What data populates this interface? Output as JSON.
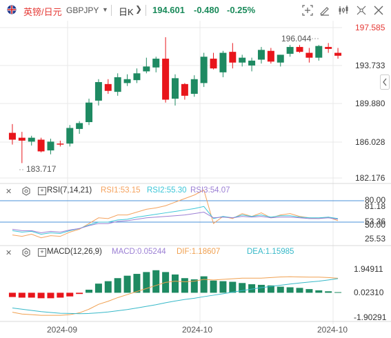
{
  "toolbar": {
    "pair_name": "英镑/日元",
    "symbol": "GBPJPY",
    "period": "日K",
    "price": "194.601",
    "change": "-0.480",
    "change_pct": "-0.25%"
  },
  "colors": {
    "up": "#1e8a62",
    "down": "#e8151b",
    "rsi1": "#f5a25d",
    "rsi2": "#3cc6d8",
    "rsi3": "#9b7fd4",
    "dif": "#f0a050",
    "dea": "#36b8c8",
    "grid": "#e8e8e8"
  },
  "icons": [
    "flag-uk-icon",
    "crosshair-icon",
    "draw-line-icon",
    "indicators-icon",
    "shapes-icon",
    "fullscreen-icon",
    "close-icon",
    "chevron-down-icon",
    "chevron-left-icon",
    "gear-icon",
    "plus-box-icon"
  ],
  "chart_data": [
    {
      "type": "candlestick",
      "title": "GBPJPY 日K",
      "y_ticks": [
        "197.585",
        "193.733",
        "189.880",
        "186.028",
        "182.176"
      ],
      "ylim": [
        182.176,
        197.585
      ],
      "x_ticks": [
        "2024-09",
        "2024-10",
        "2024-10"
      ],
      "annotations": {
        "high": "196.044",
        "low": "183.717"
      },
      "candles": [
        {
          "o": 186.8,
          "h": 187.7,
          "l": 185.6,
          "c": 186.1
        },
        {
          "o": 186.3,
          "h": 186.9,
          "l": 183.7,
          "c": 186.0
        },
        {
          "o": 185.9,
          "h": 186.5,
          "l": 185.5,
          "c": 186.3
        },
        {
          "o": 186.1,
          "h": 186.3,
          "l": 184.8,
          "c": 184.9
        },
        {
          "o": 185.0,
          "h": 186.2,
          "l": 184.6,
          "c": 185.9
        },
        {
          "o": 185.7,
          "h": 186.0,
          "l": 185.4,
          "c": 185.6
        },
        {
          "o": 185.7,
          "h": 187.6,
          "l": 185.4,
          "c": 187.3
        },
        {
          "o": 187.2,
          "h": 188.0,
          "l": 186.7,
          "c": 187.8
        },
        {
          "o": 187.9,
          "h": 190.3,
          "l": 187.6,
          "c": 189.9
        },
        {
          "o": 190.1,
          "h": 192.3,
          "l": 189.6,
          "c": 192.0
        },
        {
          "o": 191.8,
          "h": 192.3,
          "l": 190.8,
          "c": 191.1
        },
        {
          "o": 191.0,
          "h": 192.9,
          "l": 190.6,
          "c": 192.5
        },
        {
          "o": 191.9,
          "h": 192.8,
          "l": 191.6,
          "c": 192.3
        },
        {
          "o": 192.2,
          "h": 193.4,
          "l": 191.9,
          "c": 192.9
        },
        {
          "o": 193.1,
          "h": 194.5,
          "l": 192.9,
          "c": 193.6
        },
        {
          "o": 193.5,
          "h": 194.6,
          "l": 193.0,
          "c": 194.4
        },
        {
          "o": 194.4,
          "h": 196.6,
          "l": 189.9,
          "c": 190.2
        },
        {
          "o": 190.3,
          "h": 192.8,
          "l": 189.6,
          "c": 192.4
        },
        {
          "o": 191.8,
          "h": 191.9,
          "l": 190.2,
          "c": 190.6
        },
        {
          "o": 190.8,
          "h": 192.7,
          "l": 190.5,
          "c": 192.3
        },
        {
          "o": 191.9,
          "h": 195.0,
          "l": 191.5,
          "c": 194.6
        },
        {
          "o": 194.4,
          "h": 195.0,
          "l": 193.3,
          "c": 193.4
        },
        {
          "o": 193.0,
          "h": 195.2,
          "l": 192.5,
          "c": 195.0
        },
        {
          "o": 195.1,
          "h": 196.0,
          "l": 193.4,
          "c": 194.0
        },
        {
          "o": 194.0,
          "h": 194.8,
          "l": 193.6,
          "c": 194.5
        },
        {
          "o": 193.7,
          "h": 194.5,
          "l": 193.1,
          "c": 194.2
        },
        {
          "o": 194.3,
          "h": 195.6,
          "l": 193.9,
          "c": 195.3
        },
        {
          "o": 195.2,
          "h": 195.5,
          "l": 193.9,
          "c": 194.1
        },
        {
          "o": 194.0,
          "h": 194.8,
          "l": 193.6,
          "c": 194.8
        },
        {
          "o": 194.9,
          "h": 195.8,
          "l": 194.6,
          "c": 195.6
        },
        {
          "o": 195.6,
          "h": 195.8,
          "l": 195.0,
          "c": 195.1
        },
        {
          "o": 195.0,
          "h": 195.5,
          "l": 194.0,
          "c": 194.5
        },
        {
          "o": 194.5,
          "h": 195.8,
          "l": 194.2,
          "c": 195.7
        },
        {
          "o": 195.6,
          "h": 196.0,
          "l": 195.0,
          "c": 195.4
        },
        {
          "o": 195.0,
          "h": 195.5,
          "l": 194.4,
          "c": 194.7
        }
      ]
    },
    {
      "type": "line",
      "name": "RSI",
      "header": {
        "label": "RSI(7,14,21)",
        "rsi1": "RSI1:53.15",
        "rsi2": "RSI2:55.30",
        "rsi3": "RSI3:54.07"
      },
      "y_ticks": [
        "80.00",
        "81.18",
        "53.36",
        "50.00",
        "25.53"
      ],
      "ylim": [
        15,
        90
      ],
      "reference_lines": [
        80,
        50
      ],
      "series": [
        {
          "name": "RSI1",
          "values": [
            32,
            30,
            33,
            28,
            31,
            30,
            36,
            40,
            48,
            56,
            55,
            60,
            60,
            64,
            68,
            70,
            73,
            78,
            83,
            88,
            95,
            48,
            58,
            55,
            62,
            58,
            63,
            56,
            60,
            62,
            58,
            56,
            55,
            57,
            52
          ]
        },
        {
          "name": "RSI2",
          "values": [
            38,
            36,
            37,
            33,
            35,
            34,
            38,
            41,
            46,
            50,
            50,
            53,
            54,
            57,
            59,
            61,
            63,
            65,
            67,
            69,
            72,
            55,
            58,
            56,
            60,
            58,
            60,
            57,
            59,
            59,
            57,
            56,
            56,
            57,
            55
          ]
        },
        {
          "name": "RSI3",
          "values": [
            40,
            38,
            38,
            35,
            37,
            36,
            39,
            41,
            45,
            48,
            48,
            51,
            52,
            54,
            56,
            57,
            58,
            59,
            60,
            62,
            64,
            56,
            57,
            56,
            58,
            57,
            58,
            56,
            57,
            57,
            56,
            55,
            55,
            56,
            54
          ]
        }
      ]
    },
    {
      "type": "bar",
      "name": "MACD",
      "header": {
        "label": "MACD(12,26,9)",
        "macd": "MACD:0.05244",
        "dif": "DIF:1.18607",
        "dea": "DEA:1.15985"
      },
      "y_ticks": [
        "1.94911",
        "0.02310",
        "-1.90291"
      ],
      "ylim": [
        -2.1,
        2.3
      ],
      "histogram": [
        -0.35,
        -0.4,
        -0.4,
        -0.45,
        -0.45,
        -0.4,
        -0.3,
        -0.1,
        0.25,
        0.75,
        0.95,
        1.2,
        1.4,
        1.55,
        1.7,
        1.85,
        1.7,
        1.5,
        1.2,
        1.1,
        1.35,
        1.0,
        0.95,
        0.9,
        0.8,
        0.7,
        0.65,
        0.6,
        0.5,
        0.45,
        0.4,
        0.3,
        0.2,
        0.12,
        0.05
      ],
      "series": [
        {
          "name": "DIF",
          "values": [
            -1.6,
            -1.75,
            -1.8,
            -1.85,
            -1.85,
            -1.85,
            -1.8,
            -1.65,
            -1.35,
            -0.95,
            -0.7,
            -0.4,
            -0.15,
            0.1,
            0.35,
            0.6,
            0.85,
            0.95,
            0.9,
            0.95,
            1.1,
            1.05,
            1.1,
            1.15,
            1.2,
            1.2,
            1.2,
            1.25,
            1.3,
            1.32,
            1.3,
            1.28,
            1.28,
            1.25,
            1.19
          ]
        },
        {
          "name": "DEA",
          "values": [
            -1.25,
            -1.35,
            -1.45,
            -1.55,
            -1.62,
            -1.68,
            -1.7,
            -1.72,
            -1.7,
            -1.65,
            -1.58,
            -1.48,
            -1.38,
            -1.25,
            -1.12,
            -0.98,
            -0.82,
            -0.68,
            -0.55,
            -0.45,
            -0.32,
            -0.2,
            -0.08,
            0.05,
            0.18,
            0.3,
            0.42,
            0.52,
            0.62,
            0.72,
            0.8,
            0.88,
            0.95,
            1.05,
            1.16
          ]
        }
      ]
    }
  ]
}
